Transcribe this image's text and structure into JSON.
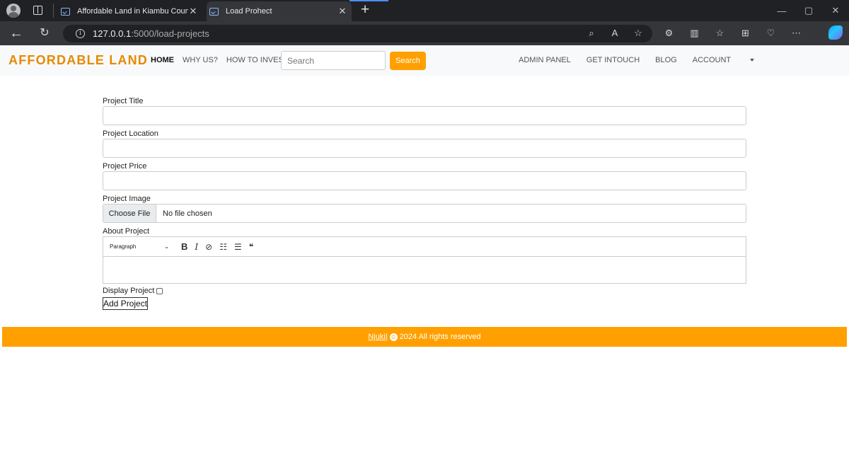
{
  "browser": {
    "tabs": [
      {
        "title": "Affordable Land in Kiambu Coun",
        "close": "✕"
      },
      {
        "title": "Load Prohect",
        "close": "✕"
      }
    ],
    "new_tab": "+",
    "address": {
      "host": "127.0.0.1",
      "path": ":5000/load-projects"
    },
    "window": {
      "minimize": "—",
      "restore": "▢",
      "close": "✕"
    }
  },
  "site": {
    "brand": "AFFORDABLE LAND",
    "nav": [
      "HOME",
      "WHY US?",
      "HOW TO INVEST"
    ],
    "search": {
      "placeholder": "Search",
      "button": "Search"
    },
    "right_nav": [
      "ADMIN PANEL",
      "GET INTOUCH",
      "BLOG",
      "ACCOUNT"
    ],
    "accent_color": "#ffa000",
    "brand_color": "#e68a00"
  },
  "form": {
    "labels": {
      "title": "Project Title",
      "location": "Project Location",
      "price": "Project Price",
      "image": "Project Image",
      "about": "About Project",
      "display": "Display Project"
    },
    "file": {
      "button": "Choose File",
      "status": "No file chosen"
    },
    "editor": {
      "paragraph": "Paragraph"
    },
    "submit": "Add Project"
  },
  "footer": {
    "link": "Njuki",
    "separator": " | ",
    "copyright": "©",
    "text": "2024 All rights reserved"
  }
}
